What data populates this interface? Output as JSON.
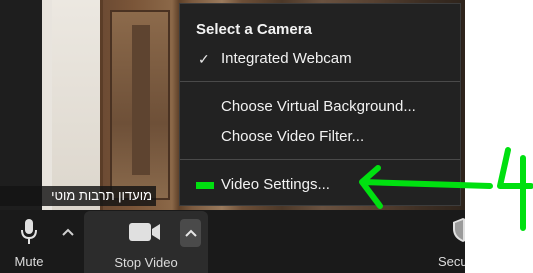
{
  "name_tag": "מועדון תרבות מוטי",
  "camera_menu": {
    "title": "Select a Camera",
    "selected_camera": "Integrated Webcam",
    "items": [
      "Choose Virtual Background...",
      "Choose Video Filter...",
      "Video Settings..."
    ]
  },
  "toolbar": {
    "mute_label": "Mute",
    "stop_video_label": "Stop Video",
    "security_label": "Secu"
  },
  "annotation": {
    "number": "4",
    "color": "#00e010"
  },
  "icons": {
    "check": "check-icon",
    "mic": "microphone-icon",
    "camera": "video-camera-icon",
    "chevron": "chevron-up-icon",
    "shield": "shield-icon"
  },
  "colors": {
    "menu_bg": "#222222",
    "toolbar_bg": "#1a1a1a",
    "highlight": "#00e010"
  }
}
